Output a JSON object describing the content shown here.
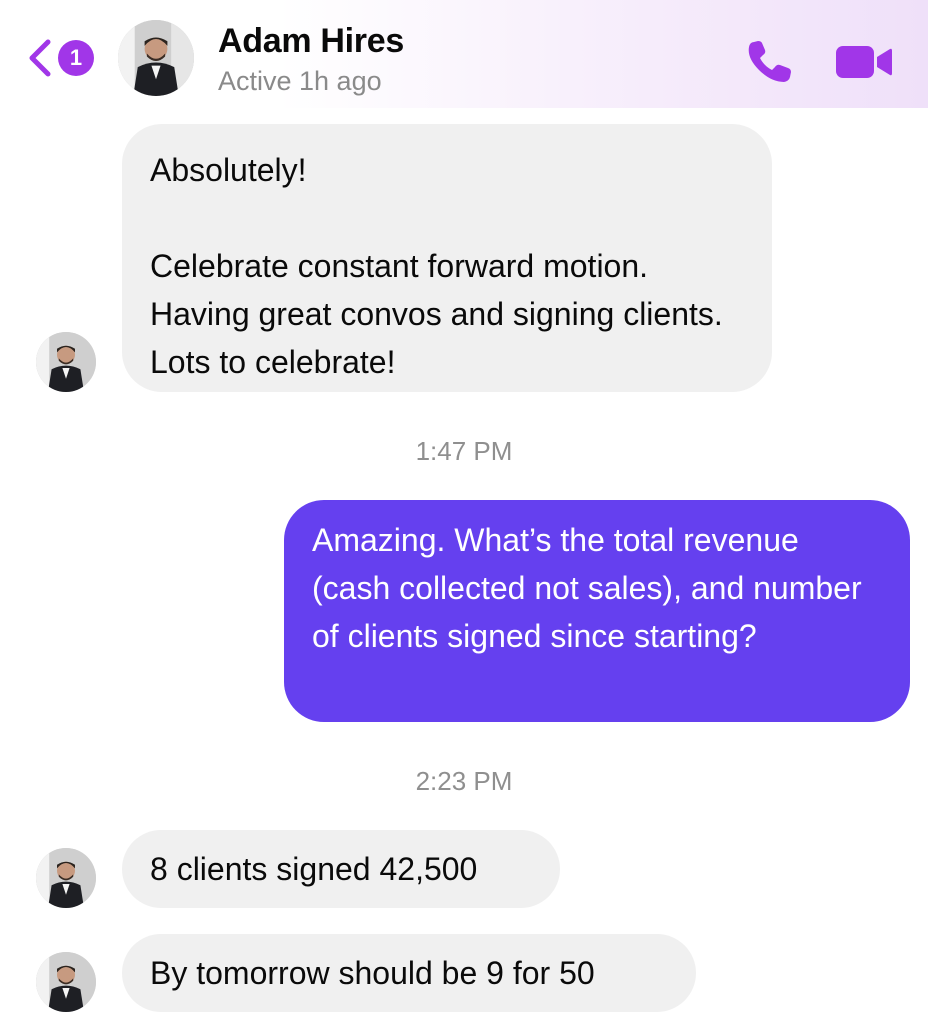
{
  "header": {
    "unread_count": "1",
    "contact_name": "Adam Hires",
    "status": "Active 1h ago"
  },
  "colors": {
    "accent": "#a136e8",
    "outgoing_bubble": "#6540ef",
    "incoming_bubble": "#f0f0f0"
  },
  "icons": {
    "back": "chevron-left-icon",
    "call": "phone-icon",
    "video": "video-camera-icon"
  },
  "messages": [
    {
      "from": "contact",
      "text": "Absolutely!\n\nCelebrate constant forward motion. Having great convos and signing clients. Lots to celebrate!"
    },
    {
      "timestamp": "1:47 PM"
    },
    {
      "from": "me",
      "text": "Amazing. What’s the total revenue (cash collected not sales), and number of clients signed since starting?"
    },
    {
      "timestamp": "2:23 PM"
    },
    {
      "from": "contact",
      "text": "8 clients signed 42,500"
    },
    {
      "from": "contact",
      "text": "By tomorrow should be 9 for 50"
    }
  ]
}
